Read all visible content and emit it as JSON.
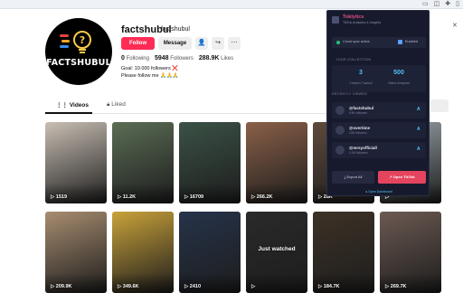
{
  "profile": {
    "username": "factshubul",
    "nickname": "factshubul",
    "logo_text": "FACTSHUBUL",
    "follow_label": "Follow",
    "message_label": "Message",
    "stats": {
      "following": "0",
      "following_label": "Following",
      "followers": "5948",
      "followers_label": "Followers",
      "likes": "288.9K",
      "likes_label": "Likes"
    },
    "bio_line1": "Goal: 10.000 followers ❌",
    "bio_line2": "Please follow me 🙏🙏🙏"
  },
  "tabs": [
    {
      "label": "Videos"
    },
    {
      "label": "Liked"
    }
  ],
  "videos": [
    {
      "views": "1519",
      "overlay": "",
      "color": "#c9bfb4"
    },
    {
      "views": "11.2K",
      "overlay": "",
      "color": "#5b6d55"
    },
    {
      "views": "16709",
      "overlay": "",
      "color": "#3b5246"
    },
    {
      "views": "266.2K",
      "overlay": "",
      "color": "#8a6048"
    },
    {
      "views": "28K",
      "overlay": "",
      "color": "#5e4a3c"
    },
    {
      "views": "",
      "overlay": "",
      "color": "#9aa3a8"
    },
    {
      "views": "209.9K",
      "overlay": "",
      "color": "#a88d70"
    },
    {
      "views": "349.6K",
      "overlay": "",
      "color": "#c9a23a"
    },
    {
      "views": "2410",
      "overlay": "",
      "color": "#26334a"
    },
    {
      "views": "",
      "overlay": "Just watched",
      "color": "#2a2a2a"
    },
    {
      "views": "184.7K",
      "overlay": "",
      "color": "#3d3226"
    },
    {
      "views": "269.7K",
      "overlay": "",
      "color": "#6c5a52"
    }
  ],
  "extension": {
    "name": "Toklytics",
    "tagline": "TikTok Analytics & Insights",
    "sync_label": "Cloud sync active",
    "sync_enabled": "Enabled",
    "collection_label": "YOUR COLLECTION",
    "creators_count": "3",
    "creators_caption": "Creators Tracked",
    "videos_count": "500",
    "videos_caption": "Videos Analyzed",
    "recent_label": "RECENTLY VIEWED",
    "recent": [
      {
        "name": "@factshubul",
        "sub": "5.9K followers",
        "badge": "A"
      },
      {
        "name": "@overtime",
        "sub": "12M followers",
        "badge": "A"
      },
      {
        "name": "@mrsyofficiall",
        "sub": "1.1M followers",
        "badge": "A"
      }
    ],
    "export_label": "Export All",
    "open_label": "Open TikTok",
    "footer_label": "Open Dashboard",
    "accent": "#e5445f",
    "count_color": "#4fc3f7"
  }
}
